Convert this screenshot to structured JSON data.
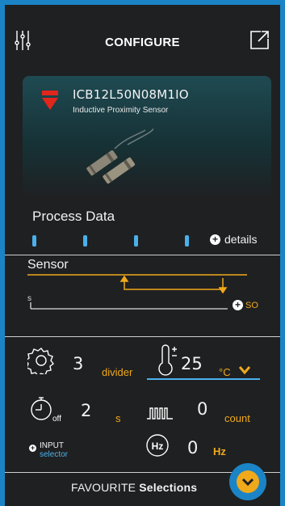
{
  "header": {
    "title": "CONFIGURE",
    "left_icon": "sliders-icon",
    "right_icon": "external-link-icon"
  },
  "device": {
    "model": "ICB12L50N08M1IO",
    "description": "Inductive Proximity Sensor",
    "brand_color": "#e1261c"
  },
  "process_data": {
    "title": "Process Data",
    "details_label": "details",
    "bar_count": 4
  },
  "sensor": {
    "title": "Sensor",
    "axis_label": "s",
    "so_label": "SO"
  },
  "params": {
    "divider": {
      "value": "3",
      "unit": "divider",
      "icon": "gear-icon"
    },
    "temperature": {
      "value": "25",
      "unit": "°C",
      "icon": "thermometer-icon"
    },
    "time_off": {
      "value": "2",
      "unit": "s",
      "icon": "stopwatch-icon",
      "icon_label": "off"
    },
    "count": {
      "value": "0",
      "unit": "count",
      "icon": "pulse-icon"
    },
    "input": {
      "line1": "INPUT",
      "line2": "selector"
    },
    "frequency": {
      "value": "0",
      "unit": "Hz",
      "icon_label": "Hz"
    }
  },
  "footer": {
    "label_regular": "FAVOURITE",
    "label_bold": "Selections"
  },
  "colors": {
    "accent_blue": "#1b84c6",
    "accent_orange": "#f0a91a",
    "bar_blue": "#4bb0ea",
    "background": "#1f2022"
  }
}
